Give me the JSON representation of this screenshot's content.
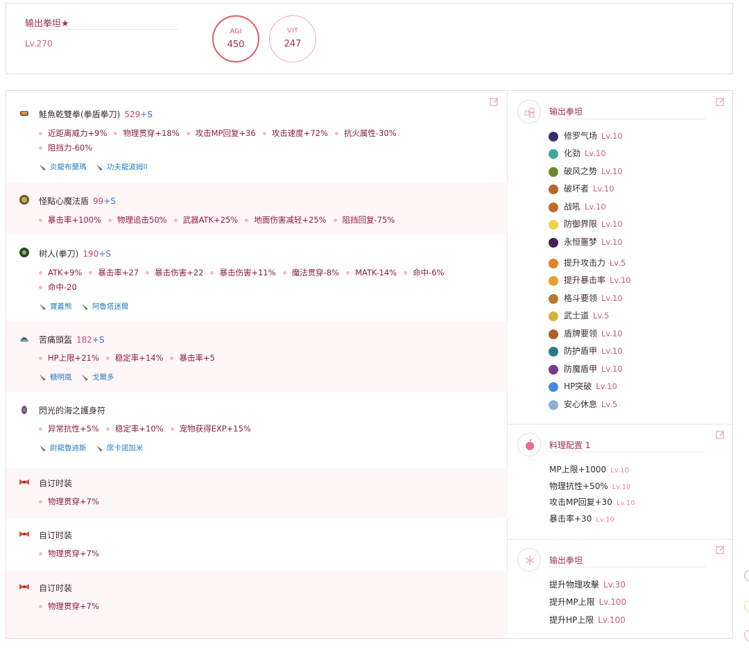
{
  "character": {
    "name": "输出拳坦★",
    "level": "Lv.270"
  },
  "stats": [
    {
      "label": "AGI",
      "value": "450"
    },
    {
      "label": "VIT",
      "value": "247"
    }
  ],
  "equipment": [
    {
      "name": "鮭魚乾雙拳(拳盾拳刀)",
      "refine": "529",
      "plus": "+S",
      "stats": [
        "近距离威力+9%",
        "物理贯穿+18%",
        "攻击MP回复+36",
        "攻击速度+72%",
        "抗火属性-30%",
        "阻挡力-60%"
      ],
      "crystals": [
        "炎龍布蘭瑪",
        "功夫龍波姆II"
      ]
    },
    {
      "name": "怪點心魔法盾",
      "refine": "99",
      "plus": "+S",
      "stats": [
        "暴击率+100%",
        "物理追击50%",
        "武器ATK+25%",
        "地面伤害减轻+25%",
        "阻挡回复-75%"
      ],
      "crystals": []
    },
    {
      "name": "树人(拳刀)",
      "refine": "190",
      "plus": "+S",
      "stats": [
        "ATK+9%",
        "暴击率+27",
        "暴击伤害+22",
        "暴击伤害+11%",
        "魔法贯穿-8%",
        "MATK-14%",
        "命中-6%",
        "命中-20"
      ],
      "crystals": [
        "寶蓋熊",
        "阿魯塔迷爾"
      ]
    },
    {
      "name": "苦痛頭盔",
      "refine": "182",
      "plus": "+S",
      "stats": [
        "HP上限+21%",
        "稳定率+14%",
        "暴击率+5"
      ],
      "crystals": [
        "糖明凰",
        "戈爾多"
      ]
    },
    {
      "name": "閃光的海之護身符",
      "refine": "",
      "plus": "",
      "stats": [
        "异常抗性+5%",
        "稳定率+10%",
        "宠物获得EXP+15%"
      ],
      "crystals": [
        "尉龍魯迪斯",
        "席卡諾加米"
      ]
    },
    {
      "name": "自订时装",
      "refine": "",
      "plus": "",
      "stats": [
        "物理贯穿+7%"
      ],
      "crystals": []
    },
    {
      "name": "自订时装",
      "refine": "",
      "plus": "",
      "stats": [
        "物理贯穿+7%"
      ],
      "crystals": []
    },
    {
      "name": "自订时装",
      "refine": "",
      "plus": "",
      "stats": [
        "物理贯穿+7%"
      ],
      "crystals": []
    }
  ],
  "skills_section": {
    "title": "输出拳坦",
    "group1": [
      {
        "name": "修罗气场",
        "level": "Lv.10",
        "color": "#3a2a6a"
      },
      {
        "name": "化劲",
        "level": "Lv.10",
        "color": "#3fa7a0"
      },
      {
        "name": "破风之势",
        "level": "Lv.10",
        "color": "#6a8a2a"
      },
      {
        "name": "破坏者",
        "level": "Lv.10",
        "color": "#b5652b"
      },
      {
        "name": "战吼",
        "level": "Lv.10",
        "color": "#c06a2a"
      },
      {
        "name": "防御界限",
        "level": "Lv.10",
        "color": "#f2d24a"
      },
      {
        "name": "永恒噩梦",
        "level": "Lv.10",
        "color": "#4b1f5e"
      }
    ],
    "group2": [
      {
        "name": "提升攻击力",
        "level": "Lv.5",
        "color": "#e0822a"
      },
      {
        "name": "提升暴击率",
        "level": "Lv.10",
        "color": "#e8a22a"
      },
      {
        "name": "格斗要领",
        "level": "Lv.10",
        "color": "#b37a2a"
      },
      {
        "name": "武士道",
        "level": "Lv.5",
        "color": "#d4b23a"
      },
      {
        "name": "盾牌要领",
        "level": "Lv.10",
        "color": "#a8622a"
      },
      {
        "name": "防护盾甲",
        "level": "Lv.10",
        "color": "#2a7a8a"
      },
      {
        "name": "防魔盾甲",
        "level": "Lv.10",
        "color": "#7a3a8a"
      },
      {
        "name": "HP突破",
        "level": "Lv.10",
        "color": "#4a8ad8"
      },
      {
        "name": "安心休息",
        "level": "Lv.5",
        "color": "#8ab0d8"
      }
    ]
  },
  "food_section": {
    "title": "料理配置 1",
    "items": [
      {
        "name": "MP上限+1000",
        "level": "Lv.10"
      },
      {
        "name": "物理抗性+50%",
        "level": "Lv.10"
      },
      {
        "name": "攻击MP回复+30",
        "level": "Lv.10"
      },
      {
        "name": "暴击率+30",
        "level": "Lv.10"
      }
    ]
  },
  "registlet_section": {
    "title": "输出拳坦",
    "items": [
      {
        "name": "提升物理攻擊",
        "level": "Lv.30"
      },
      {
        "name": "提升MP上限",
        "level": "Lv.100"
      },
      {
        "name": "提升HP上限",
        "level": "Lv.100"
      }
    ]
  },
  "colors": {
    "accent": "#d05a7c",
    "title": "#9b2f55",
    "stat": "#8b1c45",
    "crystal": "#2e7fbf",
    "row_alt": "#fff6f8"
  }
}
